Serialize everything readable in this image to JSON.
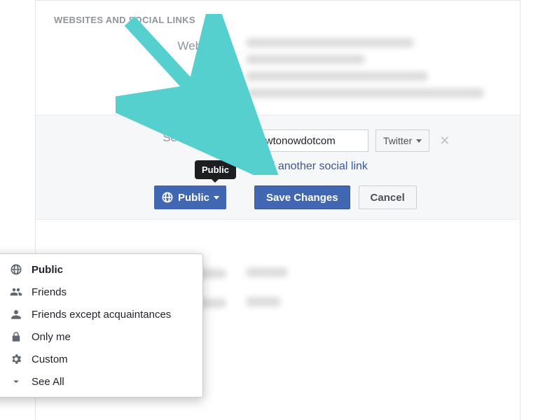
{
  "section_header": "WEBSITES AND SOCIAL LINKS",
  "websites_label": "Websites",
  "social_links_label": "Social Links",
  "social_input_value": "howtonowdotcom",
  "platform_selected": "Twitter",
  "add_another": "+ Add another social link",
  "privacy_tooltip": "Public",
  "privacy_button_label": "Public",
  "save_label": "Save Changes",
  "cancel_label": "Cancel",
  "dropdown": {
    "items": [
      {
        "label": "Public",
        "icon": "globe",
        "selected": true
      },
      {
        "label": "Friends",
        "icon": "friends",
        "selected": false
      },
      {
        "label": "Friends except acquaintances",
        "icon": "friend-except",
        "selected": false
      },
      {
        "label": "Only me",
        "icon": "lock",
        "selected": false
      },
      {
        "label": "Custom",
        "icon": "gear",
        "selected": false
      },
      {
        "label": "See All",
        "icon": "caret",
        "selected": false
      }
    ]
  }
}
